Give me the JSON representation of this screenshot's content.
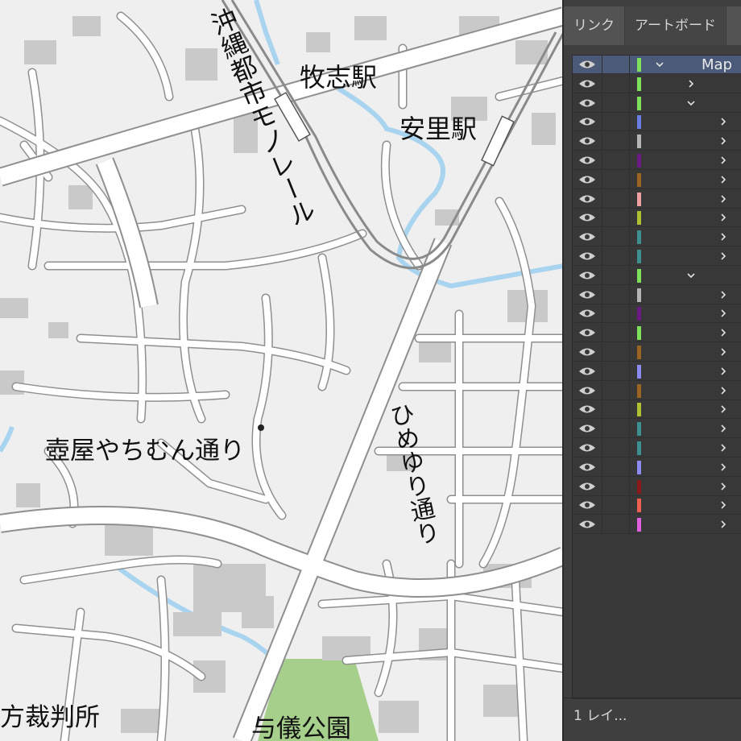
{
  "map": {
    "labels": {
      "monorail": "沖縄都市モノレール",
      "makishi_station": "牧志駅",
      "asato_station": "安里駅",
      "himeyuri_street": "ひめゆり通り",
      "tsuboya_street": "壺屋やちむん通り",
      "court": "方裁判所",
      "park": "与儀公園"
    },
    "colors": {
      "background": "#efefef",
      "road": "#ffffff",
      "road_edge": "#9a9a9a",
      "water": "#a9d4f0",
      "building": "#c9c9c9",
      "park": "#a6cf8c"
    }
  },
  "panel": {
    "tabs": [
      {
        "label": "リンク"
      },
      {
        "label": "アートボード"
      }
    ],
    "top_layer_name": "Map",
    "footer": "1 レイ...",
    "rows": [
      {
        "color": "#7fe05a",
        "chevron": "down",
        "level": 0,
        "selected": true
      },
      {
        "color": "#7fe05a",
        "chevron": "right",
        "level": 1
      },
      {
        "color": "#7fe05a",
        "chevron": "down",
        "level": 1
      },
      {
        "color": "#6a7ee6",
        "chevron": "right",
        "level": 2
      },
      {
        "color": "#b5b5b5",
        "chevron": "right",
        "level": 2
      },
      {
        "color": "#6a1a80",
        "chevron": "right",
        "level": 2
      },
      {
        "color": "#9a6420",
        "chevron": "right",
        "level": 2
      },
      {
        "color": "#f0a0a0",
        "chevron": "right",
        "level": 2
      },
      {
        "color": "#b0c030",
        "chevron": "right",
        "level": 2
      },
      {
        "color": "#3d9090",
        "chevron": "right",
        "level": 2
      },
      {
        "color": "#3d9090",
        "chevron": "right",
        "level": 2
      },
      {
        "color": "#7fe05a",
        "chevron": "down",
        "level": 1
      },
      {
        "color": "#b5b5b5",
        "chevron": "right",
        "level": 2
      },
      {
        "color": "#6a1a80",
        "chevron": "right",
        "level": 2
      },
      {
        "color": "#7fe05a",
        "chevron": "right",
        "level": 2
      },
      {
        "color": "#9a6420",
        "chevron": "right",
        "level": 2
      },
      {
        "color": "#8c8cf0",
        "chevron": "right",
        "level": 2
      },
      {
        "color": "#9a6420",
        "chevron": "right",
        "level": 2
      },
      {
        "color": "#b0c030",
        "chevron": "right",
        "level": 2
      },
      {
        "color": "#3d9090",
        "chevron": "right",
        "level": 2
      },
      {
        "color": "#3d9090",
        "chevron": "right",
        "level": 2
      },
      {
        "color": "#8c8cf0",
        "chevron": "right",
        "level": 2
      },
      {
        "color": "#8a1a1a",
        "chevron": "right",
        "level": 2
      },
      {
        "color": "#f06050",
        "chevron": "right",
        "level": 2
      },
      {
        "color": "#e060e0",
        "chevron": "right",
        "level": 2
      }
    ]
  }
}
